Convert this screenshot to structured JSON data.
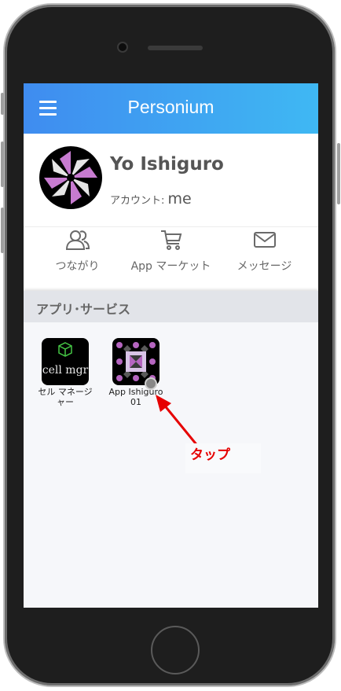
{
  "app": {
    "title": "Personium"
  },
  "profile": {
    "name": "Yo Ishiguro",
    "account_label": "アカウント: ",
    "account_value": "me"
  },
  "quick_actions": [
    {
      "label": "つながり",
      "icon": "contacts-icon"
    },
    {
      "label": "App マーケット",
      "icon": "cart-icon"
    },
    {
      "label": "メッセージ",
      "icon": "mail-icon"
    }
  ],
  "section": {
    "title": "アプリ･サービス"
  },
  "apps": [
    {
      "icon_text": "cell mgr",
      "label": "セル マネージャー"
    },
    {
      "label": "App Ishiguro 01"
    }
  ],
  "annotation": {
    "text": "タップ",
    "color": "#e60000"
  },
  "colors": {
    "appbar_start": "#3f8cf0",
    "appbar_end": "#3fb8f3",
    "annotation": "#e60000"
  }
}
